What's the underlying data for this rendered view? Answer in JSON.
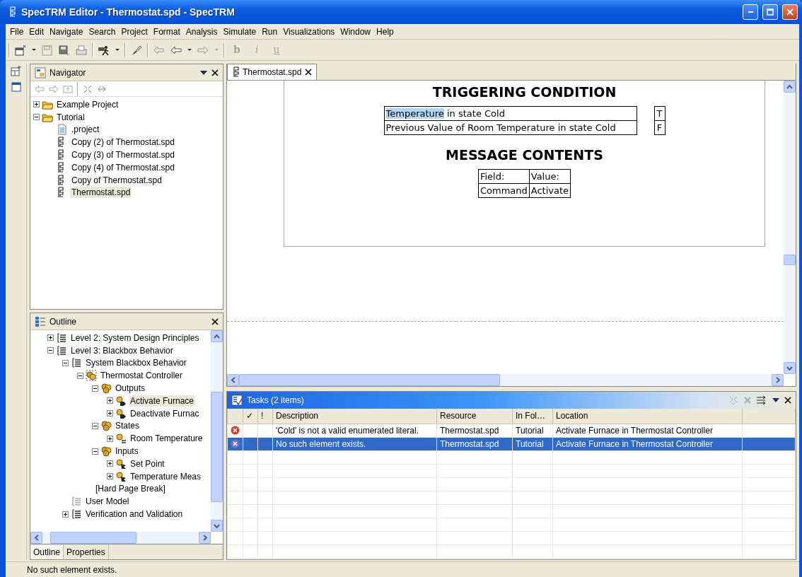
{
  "window": {
    "title": "SpecTRM Editor - Thermostat.spd - SpecTRM"
  },
  "menu": [
    "File",
    "Edit",
    "Navigate",
    "Search",
    "Project",
    "Format",
    "Analysis",
    "Simulate",
    "Run",
    "Visualizations",
    "Window",
    "Help"
  ],
  "toolbar": {
    "format_buttons": [
      "b",
      "i",
      "u"
    ]
  },
  "navigator": {
    "title": "Navigator",
    "items": [
      {
        "label": "Example Project",
        "kind": "folder",
        "expanded": false,
        "selected": false
      },
      {
        "label": "Tutorial",
        "kind": "folder",
        "expanded": true,
        "selected": false,
        "children": [
          {
            "label": ".project",
            "kind": "file",
            "selected": false
          },
          {
            "label": "Copy (2) of Thermostat.spd",
            "kind": "spd",
            "selected": false
          },
          {
            "label": "Copy (3) of Thermostat.spd",
            "kind": "spd",
            "selected": false
          },
          {
            "label": "Copy (4) of Thermostat.spd",
            "kind": "spd",
            "selected": false
          },
          {
            "label": "Copy of Thermostat.spd",
            "kind": "spd",
            "selected": false
          },
          {
            "label": "Thermostat.spd",
            "kind": "spd",
            "selected": true
          }
        ]
      }
    ]
  },
  "outline": {
    "title": "Outline",
    "items": [
      {
        "label": "Level 2: System Design Principles",
        "kind": "section",
        "expanded": false,
        "selected": false
      },
      {
        "label": "Level 3: Blackbox Behavior",
        "kind": "section",
        "expanded": true,
        "selected": false,
        "children": [
          {
            "label": "System Blackbox Behavior",
            "kind": "section",
            "expanded": true,
            "selected": false,
            "children": [
              {
                "label": "Thermostat Controller",
                "kind": "controller",
                "expanded": true,
                "selected": false,
                "children": [
                  {
                    "label": "Outputs",
                    "kind": "group",
                    "expanded": true,
                    "selected": false,
                    "children": [
                      {
                        "label": "Activate Furnace",
                        "kind": "output",
                        "expanded": false,
                        "selected": true
                      },
                      {
                        "label": "Deactivate Furnac",
                        "kind": "output",
                        "expanded": false,
                        "selected": false
                      }
                    ]
                  },
                  {
                    "label": "States",
                    "kind": "group",
                    "expanded": true,
                    "selected": false,
                    "children": [
                      {
                        "label": "Room Temperature",
                        "kind": "state",
                        "expanded": false,
                        "selected": false
                      }
                    ]
                  },
                  {
                    "label": "Inputs",
                    "kind": "group",
                    "expanded": true,
                    "selected": false,
                    "children": [
                      {
                        "label": "Set Point",
                        "kind": "input",
                        "expanded": false,
                        "selected": false
                      },
                      {
                        "label": "Temperature Meas",
                        "kind": "input",
                        "expanded": false,
                        "selected": false
                      }
                    ]
                  }
                ]
              },
              {
                "label": "[Hard Page Break]",
                "kind": "none",
                "selected": false
              }
            ]
          },
          {
            "label": "User Model",
            "kind": "section-empty",
            "selected": false
          },
          {
            "label": "Verification and Validation",
            "kind": "section",
            "expanded": false,
            "selected": false
          }
        ]
      }
    ],
    "tabs": [
      {
        "label": "Outline",
        "selected": true
      },
      {
        "label": "Properties",
        "selected": false
      }
    ]
  },
  "editor": {
    "tab": "Thermostat.spd",
    "triggering_title": "TRIGGERING CONDITION",
    "conditions": [
      {
        "parts": [
          {
            "text": "Temperature",
            "highlighted": true
          },
          {
            "text": " in state Cold",
            "highlighted": false
          }
        ],
        "value": "T"
      },
      {
        "parts": [
          {
            "text": "Previous Value of Room Temperature in state Cold",
            "highlighted": false
          }
        ],
        "value": "F"
      }
    ],
    "message_title": "MESSAGE CONTENTS",
    "message_table": {
      "columns": [
        "Field:",
        "Value:"
      ],
      "rows": [
        [
          "Command",
          "Activate"
        ]
      ]
    }
  },
  "tasks": {
    "title": "Tasks (2 items)",
    "columns": [
      "✓",
      "!",
      "Description",
      "Resource",
      "In Fol…",
      "Location"
    ],
    "rows": [
      {
        "kind": "error",
        "selected": false,
        "description": "'Cold' is not a valid enumerated literal.",
        "resource": "Thermostat.spd",
        "folder": "Tutorial",
        "location": "Activate Furnace in Thermostat Controller"
      },
      {
        "kind": "error",
        "selected": true,
        "description": "No such element exists.",
        "resource": "Thermostat.spd",
        "folder": "Tutorial",
        "location": "Activate Furnace in Thermostat Controller"
      }
    ]
  },
  "status_bar": "No such element exists."
}
